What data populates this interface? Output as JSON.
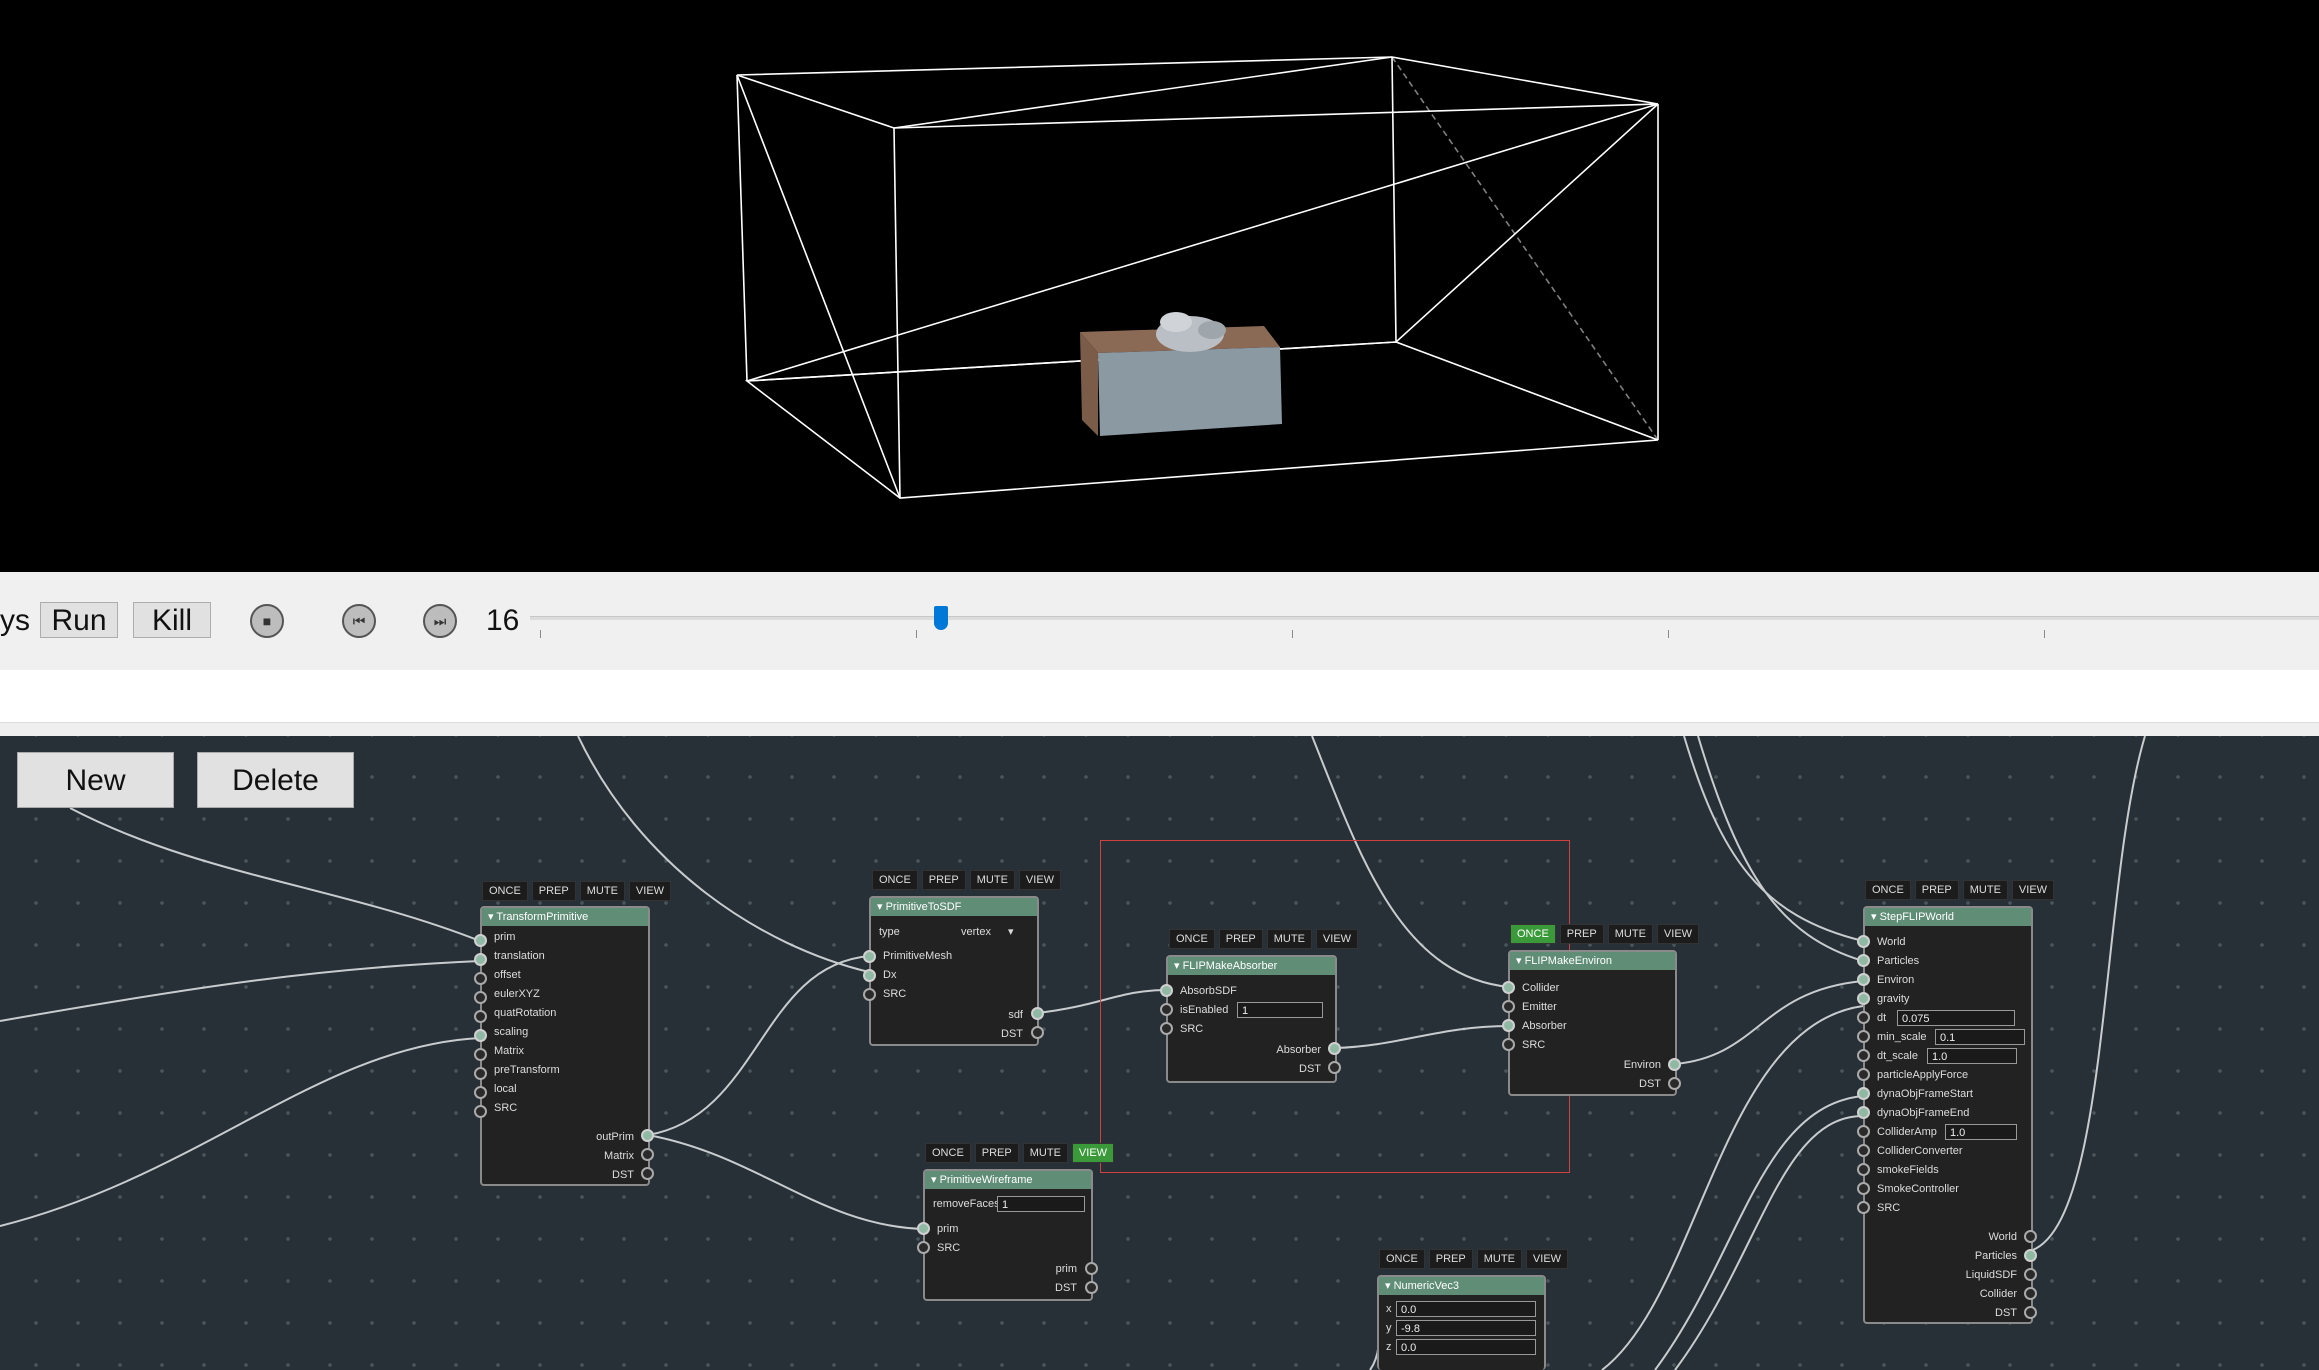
{
  "toolbar": {
    "partial_label": "ys",
    "run_label": "Run",
    "kill_label": "Kill",
    "stop_icon": "stop-icon",
    "prev_icon": "prev-frame-icon",
    "next_icon": "next-frame-icon",
    "frame": "16",
    "timeline_position": 0.23
  },
  "graph": {
    "new_label": "New",
    "delete_label": "Delete",
    "flags": {
      "once": "ONCE",
      "prep": "PREP",
      "mute": "MUTE",
      "view": "VIEW"
    },
    "nodes": {
      "transform": {
        "title": "TransformPrimitive",
        "inputs": [
          "prim",
          "translation",
          "offset",
          "eulerXYZ",
          "quatRotation",
          "scaling",
          "Matrix",
          "preTransform",
          "local",
          "SRC"
        ],
        "outputs": [
          "outPrim",
          "Matrix",
          "DST"
        ]
      },
      "tosdf": {
        "title": "PrimitiveToSDF",
        "type_label": "type",
        "type_value": "vertex",
        "inputs": [
          "PrimitiveMesh",
          "Dx",
          "SRC"
        ],
        "outputs": [
          "sdf",
          "DST"
        ]
      },
      "wireframe": {
        "title": "PrimitiveWireframe",
        "param_label": "removeFaces",
        "param_value": "1",
        "inputs": [
          "prim",
          "SRC"
        ],
        "outputs": [
          "prim",
          "DST"
        ]
      },
      "absorber": {
        "title": "FLIPMakeAbsorber",
        "inputs": [
          "AbsorbSDF",
          "isEnabled",
          "SRC"
        ],
        "isEnabled_value": "1",
        "outputs": [
          "Absorber",
          "DST"
        ]
      },
      "environ": {
        "title": "FLIPMakeEnviron",
        "inputs": [
          "Collider",
          "Emitter",
          "Absorber",
          "SRC"
        ],
        "outputs": [
          "Environ",
          "DST"
        ]
      },
      "vec3": {
        "title": "NumericVec3",
        "fields": [
          {
            "label": "x",
            "value": "0.0"
          },
          {
            "label": "y",
            "value": "-9.8"
          },
          {
            "label": "z",
            "value": "0.0"
          }
        ]
      },
      "step": {
        "title": "StepFLIPWorld",
        "inputs": [
          "World",
          "Particles",
          "Environ",
          "gravity",
          "dt",
          "min_scale",
          "dt_scale",
          "particleApplyForce",
          "dynaObjFrameStart",
          "dynaObjFrameEnd",
          "ColliderAmp",
          "ColliderConverter",
          "smokeFields",
          "SmokeController",
          "SRC"
        ],
        "dt_value": "0.075",
        "min_scale_value": "0.1",
        "dt_scale_value": "1.0",
        "collider_amp_value": "1.0",
        "outputs": [
          "World",
          "Particles",
          "LiquidSDF",
          "Collider",
          "DST"
        ]
      }
    }
  }
}
